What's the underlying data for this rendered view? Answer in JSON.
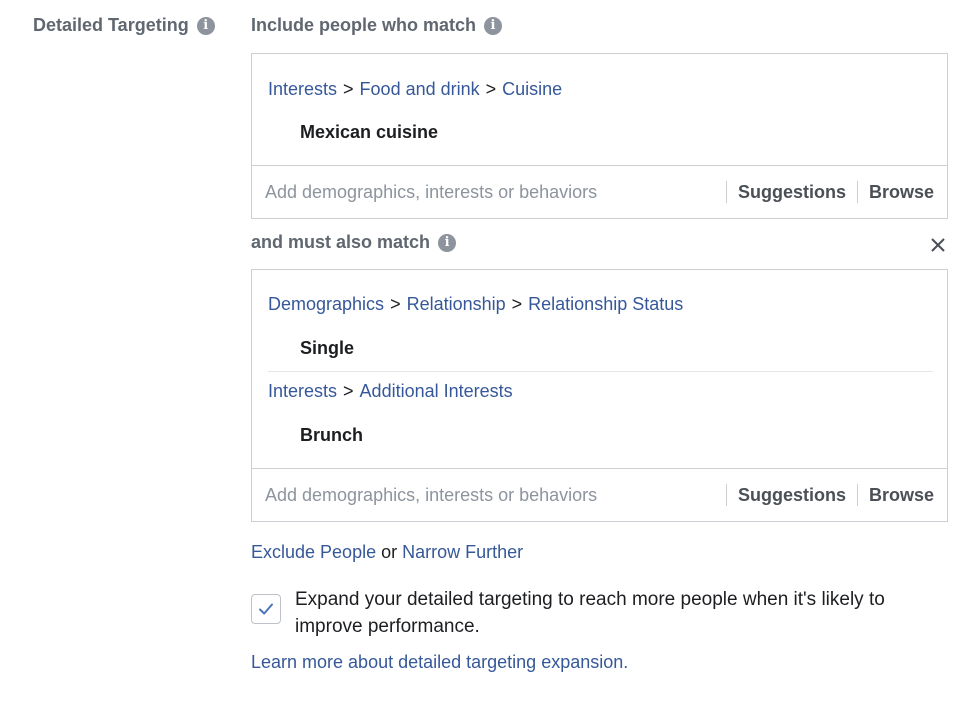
{
  "detailed_targeting": {
    "label": "Detailed Targeting",
    "include": {
      "label": "Include people who match",
      "criteria": [
        {
          "path": [
            "Interests",
            "Food and drink",
            "Cuisine"
          ],
          "items": [
            "Mexican cuisine"
          ]
        }
      ],
      "input_placeholder": "Add demographics, interests or behaviors",
      "suggestions_label": "Suggestions",
      "browse_label": "Browse"
    },
    "narrow": {
      "label": "and must also match",
      "criteria": [
        {
          "path": [
            "Demographics",
            "Relationship",
            "Relationship Status"
          ],
          "items": [
            "Single"
          ]
        },
        {
          "path": [
            "Interests",
            "Additional Interests"
          ],
          "items": [
            "Brunch"
          ]
        }
      ],
      "input_placeholder": "Add demographics, interests or behaviors",
      "suggestions_label": "Suggestions",
      "browse_label": "Browse"
    },
    "breadcrumb_separator": ">",
    "footer": {
      "exclude_label": "Exclude People",
      "or_text": "or",
      "narrow_label": "Narrow Further"
    },
    "expansion": {
      "checked": true,
      "text": "Expand your detailed targeting to reach more people when it's likely to improve performance.",
      "learn_more": "Learn more about detailed targeting expansion."
    }
  },
  "icons": {
    "info": "info-icon",
    "close": "close-icon",
    "check": "checkmark-icon"
  },
  "colors": {
    "link": "#365899",
    "label": "#606770",
    "border": "#ccd0d5",
    "check": "#4a76b8"
  }
}
